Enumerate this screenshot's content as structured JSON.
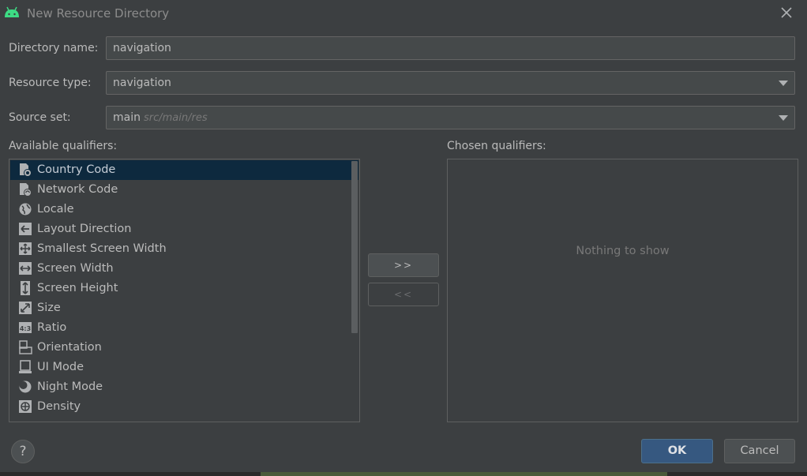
{
  "window": {
    "title": "New Resource Directory"
  },
  "form": {
    "directory_name": {
      "label": "Directory name:",
      "value": "navigation"
    },
    "resource_type": {
      "label": "Resource type:",
      "value": "navigation"
    },
    "source_set": {
      "label": "Source set:",
      "value": "main",
      "hint": "src/main/res"
    }
  },
  "available": {
    "label": "Available qualifiers:",
    "items": [
      {
        "label": "Country Code",
        "icon": "country-code-icon",
        "selected": true
      },
      {
        "label": "Network Code",
        "icon": "network-code-icon"
      },
      {
        "label": "Locale",
        "icon": "globe-icon"
      },
      {
        "label": "Layout Direction",
        "icon": "layout-direction-icon"
      },
      {
        "label": "Smallest Screen Width",
        "icon": "smallest-width-icon"
      },
      {
        "label": "Screen Width",
        "icon": "screen-width-icon"
      },
      {
        "label": "Screen Height",
        "icon": "screen-height-icon"
      },
      {
        "label": "Size",
        "icon": "size-icon"
      },
      {
        "label": "Ratio",
        "icon": "ratio-icon"
      },
      {
        "label": "Orientation",
        "icon": "orientation-icon"
      },
      {
        "label": "UI Mode",
        "icon": "ui-mode-icon"
      },
      {
        "label": "Night Mode",
        "icon": "night-mode-icon"
      },
      {
        "label": "Density",
        "icon": "density-icon"
      }
    ]
  },
  "buttons": {
    "add": ">>",
    "remove": "<<",
    "ok": "OK",
    "cancel": "Cancel",
    "help": "?"
  },
  "chosen": {
    "label": "Chosen qualifiers:",
    "empty_text": "Nothing to show"
  }
}
